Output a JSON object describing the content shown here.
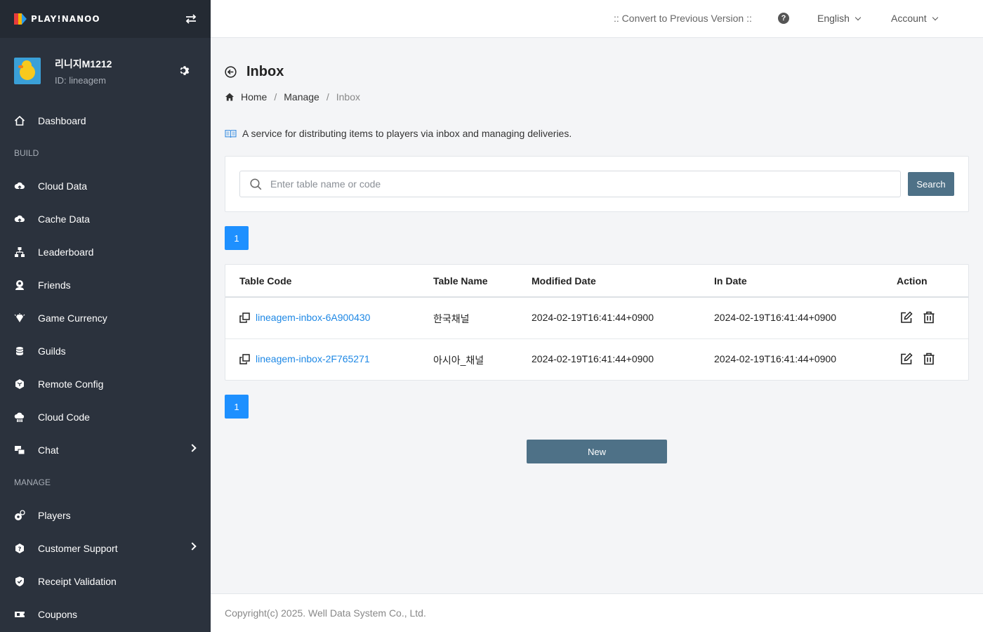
{
  "brand": {
    "logo_text": "PLAY!NANOO"
  },
  "profile": {
    "name": "리니지M1212",
    "id": "ID: lineagem"
  },
  "sidebar": {
    "dashboard": "Dashboard",
    "build_label": "BUILD",
    "build_items": [
      "Cloud Data",
      "Cache Data",
      "Leaderboard",
      "Friends",
      "Game Currency",
      "Guilds",
      "Remote Config",
      "Cloud Code",
      "Chat"
    ],
    "manage_label": "MANAGE",
    "manage_items": [
      "Players",
      "Customer Support",
      "Receipt Validation",
      "Coupons"
    ]
  },
  "topbar": {
    "convert": ":: Convert to Previous Version ::",
    "help": "?",
    "language": "English",
    "account": "Account"
  },
  "page": {
    "title": "Inbox",
    "breadcrumb": [
      "Home",
      "Manage",
      "Inbox"
    ],
    "description": "A service for distributing items to players via inbox and managing deliveries."
  },
  "search": {
    "placeholder": "Enter table name or code",
    "button": "Search"
  },
  "pagination": {
    "current": "1"
  },
  "table": {
    "headers": [
      "Table Code",
      "Table Name",
      "Modified Date",
      "In Date",
      "Action"
    ],
    "rows": [
      {
        "code": "lineagem-inbox-6A900430",
        "name": "한국채널",
        "modified": "2024-02-19T16:41:44+0900",
        "indate": "2024-02-19T16:41:44+0900"
      },
      {
        "code": "lineagem-inbox-2F765271",
        "name": "아시아_채널",
        "modified": "2024-02-19T16:41:44+0900",
        "indate": "2024-02-19T16:41:44+0900"
      }
    ]
  },
  "actions": {
    "new": "New"
  },
  "footer": {
    "copyright": "Copyright(c) 2025. Well Data System Co., Ltd."
  },
  "colors": {
    "sidebar_bg": "#2b323d",
    "primary_button": "#4e7187",
    "page_button": "#1e90ff",
    "link": "#1e88e5"
  }
}
